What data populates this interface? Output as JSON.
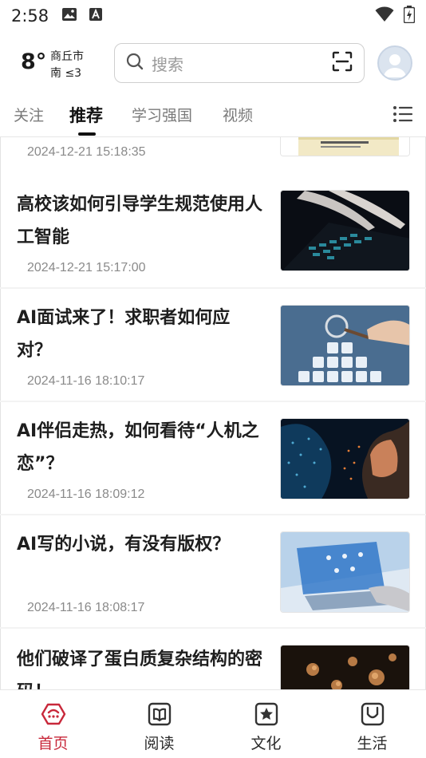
{
  "status_bar": {
    "time": "2:58"
  },
  "header": {
    "weather": {
      "temperature": "8°",
      "city": "商丘市",
      "wind": "南 ≤3"
    },
    "search": {
      "placeholder": "搜索"
    }
  },
  "tabs": [
    {
      "label": "关注"
    },
    {
      "label": "推荐"
    },
    {
      "label": "学习强国"
    },
    {
      "label": "视频"
    }
  ],
  "active_tab": "推荐",
  "articles": [
    {
      "title": "",
      "date": "2024-12-21 15:18:35",
      "image": "book-cover-thumbnail"
    },
    {
      "title": "高校该如何引导学生规范使用人工智能",
      "date": "2024-12-21 15:17:00",
      "image": "hands-on-keyboard-thumbnail"
    },
    {
      "title": "AI面试来了！求职者如何应对？",
      "date": "2024-11-16 18:10:17",
      "image": "magnifier-over-people-thumbnail"
    },
    {
      "title": "AI伴侣走热，如何看待“人机之恋”？",
      "date": "2024-11-16 18:09:12",
      "image": "digital-faces-thumbnail"
    },
    {
      "title": "AI写的小说，有没有版权？",
      "date": "2024-11-16 18:08:17",
      "image": "laptop-holograms-thumbnail"
    },
    {
      "title": "他们破译了蛋白质复杂结构的密码！",
      "date": "",
      "image": "protein-particles-thumbnail"
    }
  ],
  "bottom_nav": [
    {
      "label": "首页",
      "icon": "home-icon"
    },
    {
      "label": "阅读",
      "icon": "book-icon"
    },
    {
      "label": "文化",
      "icon": "star-frame-icon"
    },
    {
      "label": "生活",
      "icon": "smile-bag-icon"
    }
  ],
  "colors": {
    "accent": "#c8283a",
    "text": "#1e1e1e",
    "muted": "#8a8a8a"
  }
}
